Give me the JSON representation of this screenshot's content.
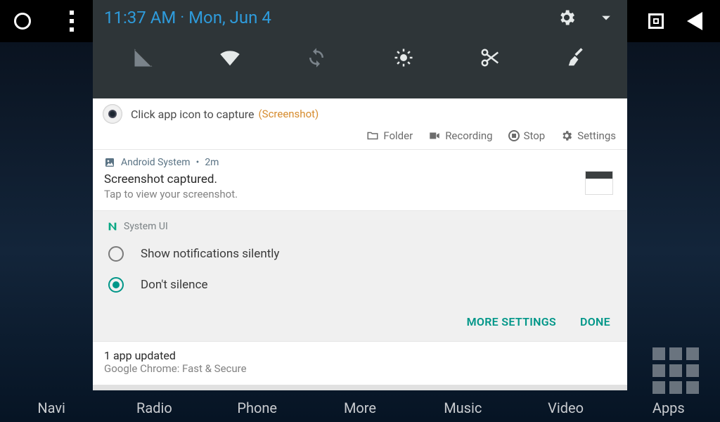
{
  "statusbar": {
    "time": "11:37 AM",
    "date": "Mon, Jun 4"
  },
  "quick_settings": {
    "tiles": [
      "signal",
      "wifi",
      "sync",
      "brightness",
      "screenshot",
      "clean"
    ]
  },
  "notifications": [
    {
      "app": "Screenshot",
      "title": "Click app icon to capture",
      "suffix": "(Screenshot)",
      "actions": {
        "folder": "Folder",
        "recording": "Recording",
        "stop": "Stop",
        "settings": "Settings"
      }
    },
    {
      "app": "Android System",
      "age": "2m",
      "title": "Screenshot captured.",
      "subtitle": "Tap to view your screenshot."
    }
  ],
  "notification_controls": {
    "app": "System UI",
    "options": {
      "silent": "Show notifications silently",
      "dont_silence": "Don't silence"
    },
    "selected": "dont_silence",
    "more_settings": "MORE SETTINGS",
    "done": "DONE"
  },
  "play_update": {
    "title": "1 app updated",
    "subtitle": "Google Chrome: Fast & Secure"
  },
  "dock": {
    "items": [
      "Navi",
      "Radio",
      "Phone",
      "More",
      "Music",
      "Video",
      "Apps"
    ]
  }
}
